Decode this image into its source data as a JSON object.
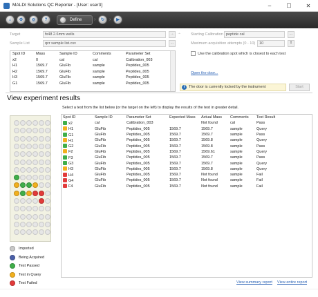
{
  "window": {
    "title": "MALDI Solutions QC Reporter - [User: user3]",
    "controls": {
      "minimize": "–",
      "maximize": "☐",
      "close": "✕"
    }
  },
  "toolbar": {
    "define_label": "Define"
  },
  "setup": {
    "target_label": "Target",
    "target_value": "fx48 2.6mm wells",
    "sample_list_label": "Sample List",
    "sample_list_value": "qcr sample list.csv",
    "calibration_label": "Starting Calibration",
    "calibration_value": "peptide cal",
    "max_label": "Maximum acquisition attempts (0 - 10)",
    "max_value": "10",
    "checkbox_label": "Use the calibration spot which is closest to each test",
    "open_door": "Open the door...",
    "lock_message": "The door is currently locked by the instrument",
    "start_label": "Start",
    "browse_label": "..."
  },
  "top_table": {
    "headers": [
      "Spot ID",
      "Mass",
      "Sample ID",
      "Comments",
      "Parameter Set"
    ],
    "rows": [
      [
        "x2",
        "0",
        "cal",
        "cal",
        "Calibration_003"
      ],
      [
        "H1",
        "1569.7",
        "GluFib",
        "sample",
        "Peptides_005"
      ],
      [
        "H2",
        "1569.7",
        "GluFib",
        "sample",
        "Peptides_005"
      ],
      [
        "H3",
        "1569.7",
        "GluFib",
        "sample",
        "Peptides_005"
      ],
      [
        "G1",
        "1569.7",
        "GluFib",
        "sample",
        "Peptides_005"
      ]
    ]
  },
  "results": {
    "title": "View experiment results",
    "hint": "Select a test from the list below (or the target on the left) to display the results of the test in greater detail.",
    "headers": [
      "Spot ID",
      "Sample ID",
      "Parameter Set",
      "Expected Mass",
      "Actual Mass",
      "Comments",
      "Test Result"
    ],
    "rows": [
      {
        "status": "passed",
        "cells": [
          "x2",
          "cal",
          "Calibration_003",
          "",
          "Not found",
          "cal",
          "Pass"
        ]
      },
      {
        "status": "query",
        "cells": [
          "H1",
          "GluFib",
          "Peptides_005",
          "1569.7",
          "1569.7",
          "sample",
          "Query"
        ]
      },
      {
        "status": "passed",
        "cells": [
          "G1",
          "GluFib",
          "Peptides_005",
          "1569.7",
          "1569.7",
          "sample",
          "Pass"
        ]
      },
      {
        "status": "query",
        "cells": [
          "H1",
          "GluFib",
          "Peptides_005",
          "1569.7",
          "1569.8",
          "sample",
          "Query"
        ]
      },
      {
        "status": "passed",
        "cells": [
          "G2",
          "GluFib",
          "Peptides_005",
          "1569.7",
          "1569.8",
          "sample",
          "Pass"
        ]
      },
      {
        "status": "query",
        "cells": [
          "F2",
          "GluFib",
          "Peptides_005",
          "1569.7",
          "1569.61",
          "sample",
          "Query"
        ]
      },
      {
        "status": "passed",
        "cells": [
          "F3",
          "GluFib",
          "Peptides_005",
          "1569.7",
          "1569.7",
          "sample",
          "Pass"
        ]
      },
      {
        "status": "passed",
        "cells": [
          "G3",
          "GluFib",
          "Peptides_005",
          "1569.7",
          "1569.7",
          "sample",
          "Query"
        ]
      },
      {
        "status": "query",
        "cells": [
          "H3",
          "GluFib",
          "Peptides_005",
          "1569.7",
          "1569.8",
          "sample",
          "Query"
        ]
      },
      {
        "status": "failed",
        "cells": [
          "H4",
          "GluFib",
          "Peptides_005",
          "1569.7",
          "Not found",
          "sample",
          "Fail"
        ]
      },
      {
        "status": "failed",
        "cells": [
          "G4",
          "GluFib",
          "Peptides_005",
          "1569.7",
          "Not found",
          "sample",
          "Fail"
        ]
      },
      {
        "status": "failed",
        "cells": [
          "F4",
          "GluFib",
          "Peptides_005",
          "1569.7",
          "Not found",
          "sample",
          "Fail"
        ]
      }
    ],
    "summary_link": "View summary report",
    "entire_link": "View entire report"
  },
  "legend": [
    {
      "label": "Imported",
      "color": "#c8c8c8"
    },
    {
      "label": "Being Acquired",
      "color": "#4a5fa8"
    },
    {
      "label": "Test Passed",
      "color": "#3fae49"
    },
    {
      "label": "Test in Query",
      "color": "#f2b01e"
    },
    {
      "label": "Test Failed",
      "color": "#e23a3a"
    }
  ],
  "status_colors": {
    "passed": "#3fae49",
    "query": "#f2b01e",
    "failed": "#e23a3a",
    "imported": "#e6e6e6"
  },
  "plate_spots": {
    "columns": 6,
    "rows": 15,
    "colored": [
      {
        "row": 7,
        "col": 0,
        "status": "passed"
      },
      {
        "row": 8,
        "col": 0,
        "status": "query"
      },
      {
        "row": 8,
        "col": 1,
        "status": "passed"
      },
      {
        "row": 8,
        "col": 2,
        "status": "passed"
      },
      {
        "row": 8,
        "col": 3,
        "status": "query"
      },
      {
        "row": 9,
        "col": 0,
        "status": "query"
      },
      {
        "row": 9,
        "col": 1,
        "status": "passed"
      },
      {
        "row": 9,
        "col": 2,
        "status": "query"
      },
      {
        "row": 9,
        "col": 3,
        "status": "failed"
      },
      {
        "row": 9,
        "col": 4,
        "status": "failed"
      },
      {
        "row": 10,
        "col": 4,
        "status": "failed"
      }
    ]
  }
}
